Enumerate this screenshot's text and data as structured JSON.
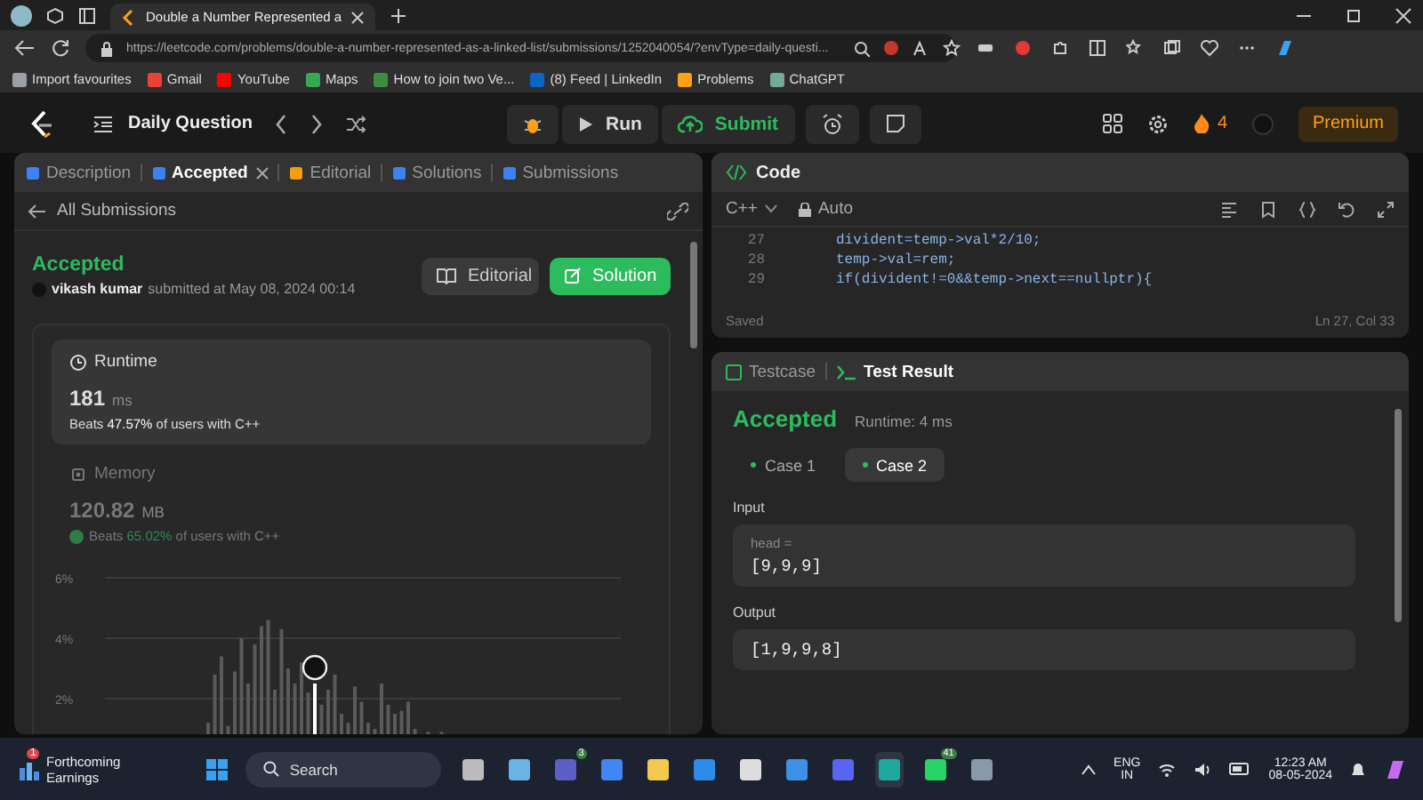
{
  "browser": {
    "tab_title": "Double a Number Represented a",
    "url": "https://leetcode.com/problems/double-a-number-represented-as-a-linked-list/submissions/1252040054/?envType=daily-questi...",
    "bookmarks": [
      {
        "label": "Import favourites",
        "color": "#9aa0a6"
      },
      {
        "label": "Gmail",
        "color": "#ea4335"
      },
      {
        "label": "YouTube",
        "color": "#ff0000"
      },
      {
        "label": "Maps",
        "color": "#34a853"
      },
      {
        "label": "How to join two Ve...",
        "color": "#3c8d40"
      },
      {
        "label": "(8) Feed | LinkedIn",
        "color": "#0a66c2"
      },
      {
        "label": "Problems",
        "color": "#ffa116"
      },
      {
        "label": "ChatGPT",
        "color": "#74aa9c"
      }
    ]
  },
  "header": {
    "title": "Daily Question",
    "run": "Run",
    "submit": "Submit",
    "streak": "4",
    "premium": "Premium"
  },
  "left_panel": {
    "tabs": [
      {
        "label": "Description",
        "selected": false,
        "closable": false,
        "color": "#3b82f6"
      },
      {
        "label": "Accepted",
        "selected": true,
        "closable": true,
        "color": "#3b82f6"
      },
      {
        "label": "Editorial",
        "selected": false,
        "closable": false,
        "color": "#f59e0b"
      },
      {
        "label": "Solutions",
        "selected": false,
        "closable": false,
        "color": "#3b82f6"
      },
      {
        "label": "Submissions",
        "selected": false,
        "closable": false,
        "color": "#3b82f6"
      }
    ],
    "back_link": "All Submissions",
    "status": "Accepted",
    "author": "vikash kumar",
    "submitted": "submitted at May 08, 2024 00:14",
    "buttons": [
      {
        "label": "Editorial",
        "kind": "secondary"
      },
      {
        "label": "Solution",
        "kind": "primary"
      }
    ],
    "stats": [
      {
        "title": "Runtime",
        "value": "181",
        "unit": "ms",
        "beats": "Beats **47.57%** of users with C++",
        "selected": true
      },
      {
        "title": "Memory",
        "value": "120.82",
        "unit": "MB",
        "beats": "Beats **65.02%** of users with C++",
        "selected": false
      }
    ],
    "histogram_ticks": [
      "6%",
      "4%",
      "2%"
    ]
  },
  "code_panel": {
    "title": "Code",
    "language": "C++",
    "mode": "Auto",
    "lines": [
      {
        "number": "27",
        "code": "divident=temp->val*2/10;"
      },
      {
        "number": "28",
        "code": "temp->val=rem;"
      },
      {
        "number": "29",
        "code": "if(divident!=0&&temp->next==nullptr){"
      }
    ],
    "status": "Saved",
    "position": "Ln 27, Col 33"
  },
  "result_panel": {
    "tabs": [
      {
        "label": "Testcase",
        "selected": false
      },
      {
        "label": "Test Result",
        "selected": true
      }
    ],
    "status": "Accepted",
    "runtime": "Runtime: 4 ms",
    "cases": [
      {
        "label": "Case 1",
        "selected": false
      },
      {
        "label": "Case 2",
        "selected": true
      }
    ],
    "input_label": "Input",
    "input_name": "head =",
    "input_value": "[9,9,9]",
    "output_label": "Output",
    "output_value": "[1,9,9,8]"
  },
  "taskbar": {
    "widget_title": "Forthcoming",
    "widget_subtitle": "Earnings",
    "widget_badge": "1",
    "search": "Search",
    "apps": [
      {
        "color": "#bbbbbb"
      },
      {
        "color": "#6bb3e6"
      },
      {
        "color": "#5b5fc7",
        "badge": "3"
      },
      {
        "color": "#4285f4"
      },
      {
        "color": "#f2c94c"
      },
      {
        "color": "#2b8be6"
      },
      {
        "color": "#dddddd"
      },
      {
        "color": "#3c91e6"
      },
      {
        "color": "#5865f2"
      },
      {
        "color": "#1fa89c",
        "selected": true
      },
      {
        "color": "#25d366",
        "badge": "41"
      },
      {
        "color": "#8899aa"
      }
    ],
    "language": "ENG",
    "region": "IN",
    "time": "12:23 AM",
    "date": "08-05-2024"
  }
}
